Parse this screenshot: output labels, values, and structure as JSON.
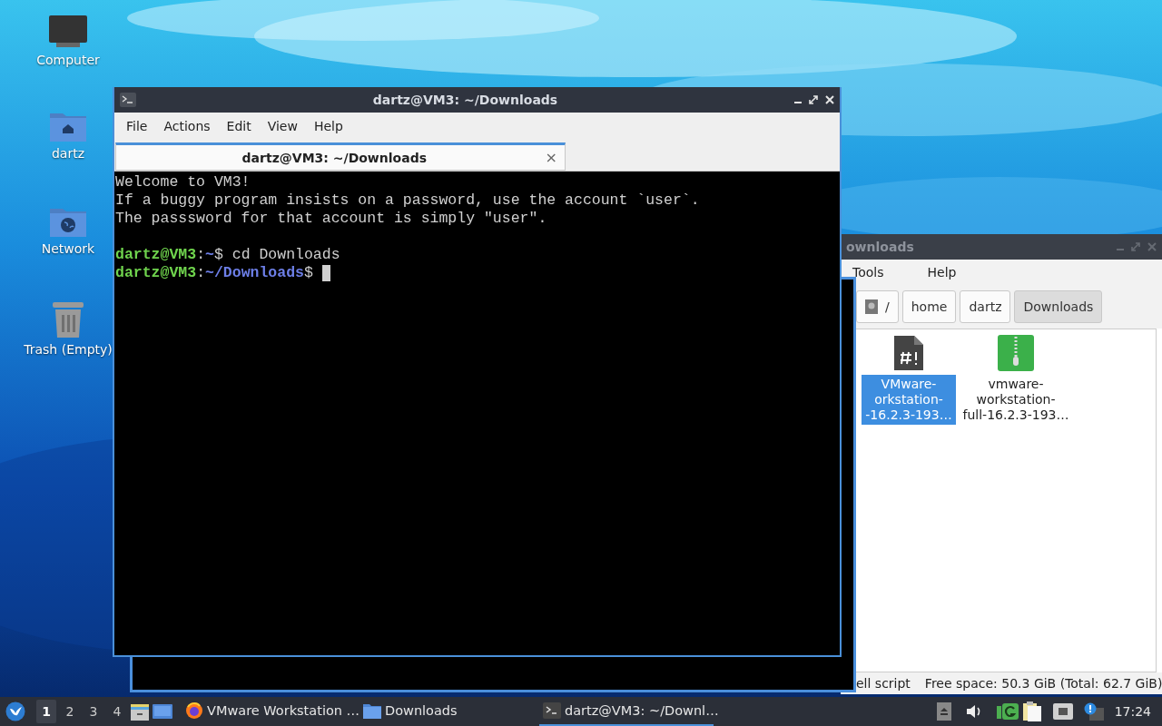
{
  "desktop_icons": [
    {
      "label": "Computer",
      "kind": "computer"
    },
    {
      "label": "dartz",
      "kind": "home"
    },
    {
      "label": "Network",
      "kind": "network"
    },
    {
      "label": "Trash (Empty)",
      "kind": "trash"
    }
  ],
  "file_manager": {
    "title": "ownloads",
    "menu": [
      "Tools",
      "Help"
    ],
    "path": [
      {
        "label": "/",
        "kind": "root",
        "selected": false
      },
      {
        "label": "home",
        "kind": "dir",
        "selected": false
      },
      {
        "label": "dartz",
        "kind": "dir",
        "selected": false
      },
      {
        "label": "Downloads",
        "kind": "dir",
        "selected": true
      }
    ],
    "files": [
      {
        "lines": [
          "VMware-",
          "orkstation-",
          "-16.2.3-193…"
        ],
        "kind": "script",
        "selected": true
      },
      {
        "lines": [
          "vmware-",
          "workstation-",
          "full-16.2.3-193…"
        ],
        "kind": "archive",
        "selected": false
      }
    ],
    "status": [
      "ell script",
      "Free space: 50.3 GiB (Total: 62.7 GiB)"
    ]
  },
  "terminal": {
    "title": "dartz@VM3: ~/Downloads",
    "menu": [
      "File",
      "Actions",
      "Edit",
      "View",
      "Help"
    ],
    "tab": {
      "label": "dartz@VM3: ~/Downloads",
      "close": "×"
    },
    "lines": [
      {
        "kind": "text",
        "segments": [
          {
            "kind": "plain",
            "text": "Welcome to VM3!"
          }
        ]
      },
      {
        "kind": "text",
        "segments": [
          {
            "kind": "plain",
            "text": "If a buggy program insists on a password, use the account `user`."
          }
        ]
      },
      {
        "kind": "text",
        "segments": [
          {
            "kind": "plain",
            "text": "The passsword for that account is simply \"user\"."
          }
        ]
      },
      {
        "kind": "blank"
      },
      {
        "kind": "text",
        "segments": [
          {
            "kind": "user",
            "text": "dartz@VM3"
          },
          {
            "kind": "plain",
            "text": ":"
          },
          {
            "kind": "path",
            "text": "~"
          },
          {
            "kind": "plain",
            "text": "$ cd Downloads"
          }
        ]
      },
      {
        "kind": "text",
        "cursor": true,
        "segments": [
          {
            "kind": "user",
            "text": "dartz@VM3"
          },
          {
            "kind": "plain",
            "text": ":"
          },
          {
            "kind": "path",
            "text": "~/Downloads"
          },
          {
            "kind": "plain",
            "text": "$"
          }
        ]
      }
    ]
  },
  "taskbar": {
    "workspaces": [
      {
        "label": "1",
        "selected": true
      },
      {
        "label": "2",
        "selected": false
      },
      {
        "label": "3",
        "selected": false
      },
      {
        "label": "4",
        "selected": false
      }
    ],
    "tasks": [
      {
        "label": "VMware Workstation …",
        "kind": "browser",
        "selected": false
      },
      {
        "label": "Downloads",
        "kind": "folder",
        "selected": false
      },
      {
        "label": "dartz@VM3: ~/Downl…",
        "kind": "terminal",
        "selected": true
      }
    ],
    "clock": "17:24"
  }
}
